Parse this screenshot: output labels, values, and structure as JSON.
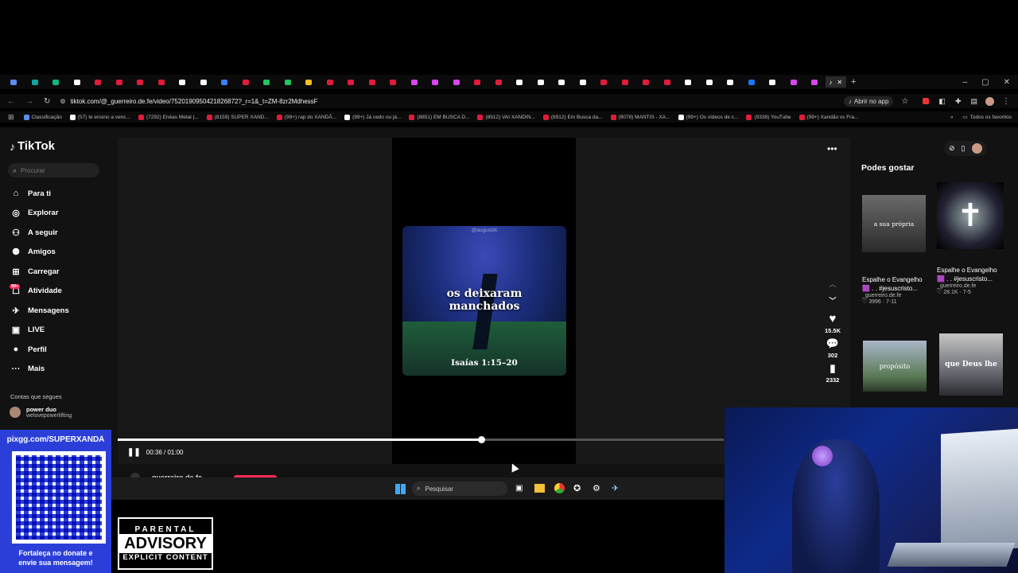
{
  "browser": {
    "url": "tiktok.com/@_guerreiro.de.fe/video/7520190950421826872?_r=1&_t=ZM-8zr2MdhessF",
    "open_in_app": "Abrir no app",
    "bookmarks": [
      {
        "label": "Classificação",
        "color": "#5b8df5"
      },
      {
        "label": "(57) Ie ensino a venc...",
        "color": "#ffffff"
      },
      {
        "label": "(7292) Enéas Metal |...",
        "color": "#e01b3c"
      },
      {
        "label": "(8159) SUPER XAND...",
        "color": "#e01b3c"
      },
      {
        "label": "(99+) rap do XANDÃ...",
        "color": "#e01b3c"
      },
      {
        "label": "(99+) Já cedo ou já...",
        "color": "#ffffff"
      },
      {
        "label": "(8851) EM BUSCA D...",
        "color": "#e01b3c"
      },
      {
        "label": "(8912) VAI XANDIN...",
        "color": "#e01b3c"
      },
      {
        "label": "(8912) Em Busca da...",
        "color": "#e01b3c"
      },
      {
        "label": "(9078) MANTIS - XA...",
        "color": "#e01b3c"
      },
      {
        "label": "(99+) Os vídeos de c...",
        "color": "#ffffff"
      },
      {
        "label": "(9338) YouTube",
        "color": "#e01b3c"
      },
      {
        "label": "(99+) Xandão vs Fra...",
        "color": "#e01b3c"
      }
    ],
    "all_bookmarks": "Todos os favoritos"
  },
  "sidebar": {
    "logo": "TikTok",
    "search_placeholder": "Procurar",
    "items": [
      {
        "label": "Para ti",
        "icon": "home-icon"
      },
      {
        "label": "Explorar",
        "icon": "compass-icon"
      },
      {
        "label": "A seguir",
        "icon": "following-icon"
      },
      {
        "label": "Amigos",
        "icon": "friends-icon"
      },
      {
        "label": "Carregar",
        "icon": "upload-icon"
      },
      {
        "label": "Atividade",
        "icon": "activity-icon"
      },
      {
        "label": "Mensagens",
        "icon": "messages-icon"
      },
      {
        "label": "LIVE",
        "icon": "live-icon"
      },
      {
        "label": "Perfil",
        "icon": "profile-icon"
      },
      {
        "label": "Mais",
        "icon": "more-icon"
      }
    ],
    "activity_badge": "99+",
    "following_heading": "Contas que segues",
    "following": [
      {
        "name": "power duo",
        "handle": "welovepowerlifting"
      }
    ]
  },
  "video": {
    "watermark": "@auguxtzk",
    "text_line1": "os deixaram",
    "text_line2": "manchados",
    "verse": "Isaías 1:15–20",
    "time": "00:36 / 01:00",
    "progress": 0.6,
    "author": "_guerreiro.de.fe",
    "likes": "15.5K",
    "comments": "302",
    "saves": "2332"
  },
  "recommend": {
    "heading": "Podes gostar",
    "cards": [
      {
        "thumb_text": "a sua própria",
        "title1": "Espalhe o Evangelho",
        "title2": "🟪 . . #jesuscristo...",
        "author": "_guerreiro.de.fe",
        "likes": "3996",
        "date": "7-11"
      },
      {
        "thumb_text": "",
        "title1": "Espalhe o Evangelho",
        "title2": "🟪 . . #jesuscristo...",
        "author": "_guerreiro.de.fe",
        "likes": "28.1K",
        "date": "7-5"
      },
      {
        "thumb_text": "propósito"
      },
      {
        "thumb_text": "que Deus lhe"
      }
    ]
  },
  "taskbar": {
    "search": "Pesquisar"
  },
  "overlay": {
    "url": "pixgg.com/SUPERXANDÃ",
    "caption1": "Fortaleça no donate e",
    "caption2": "envie sua mensagem!",
    "advisory1": "PARENTAL",
    "advisory2": "ADVISORY",
    "advisory3": "EXPLICIT CONTENT"
  }
}
